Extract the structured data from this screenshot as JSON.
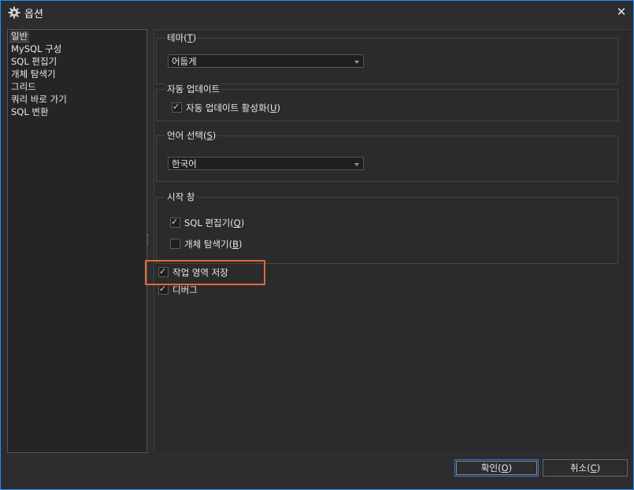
{
  "window": {
    "title": "옵션",
    "icon": "gear-icon",
    "close_label": "✕",
    "accent_color": "#1e90ff"
  },
  "sidebar": {
    "items": [
      {
        "label": "일반",
        "selected": true
      },
      {
        "label": "MySQL 구성"
      },
      {
        "label": "SQL 편집기"
      },
      {
        "label": "개체 탐색기"
      },
      {
        "label": "그리드"
      },
      {
        "label": "쿼리 바로 가기"
      },
      {
        "label": "SQL 변환"
      }
    ]
  },
  "theme": {
    "group_label": "테마",
    "mnemonic": "T",
    "selected_value": "어둡게"
  },
  "auto_update": {
    "group_label": "자동 업데이트",
    "checkbox_label": "자동 업데이트 활성화",
    "mnemonic": "U",
    "checked": true
  },
  "language": {
    "group_label": "언어 선택",
    "mnemonic": "S",
    "selected_value": "한국어"
  },
  "startup": {
    "group_label": "시작 창",
    "sql_editor_label": "SQL 편집기",
    "sql_editor_mnemonic": "Q",
    "sql_editor_checked": true,
    "object_explorer_label": "개체 탐색기",
    "object_explorer_mnemonic": "B",
    "object_explorer_checked": false
  },
  "save_workspace": {
    "label": "작업 영역 저장",
    "checked": true,
    "highlight_color": "#e06a3b"
  },
  "debug": {
    "label": "디버그",
    "checked": true
  },
  "buttons": {
    "ok_label": "확인",
    "ok_mnemonic": "O",
    "cancel_label": "취소",
    "cancel_mnemonic": "C"
  }
}
